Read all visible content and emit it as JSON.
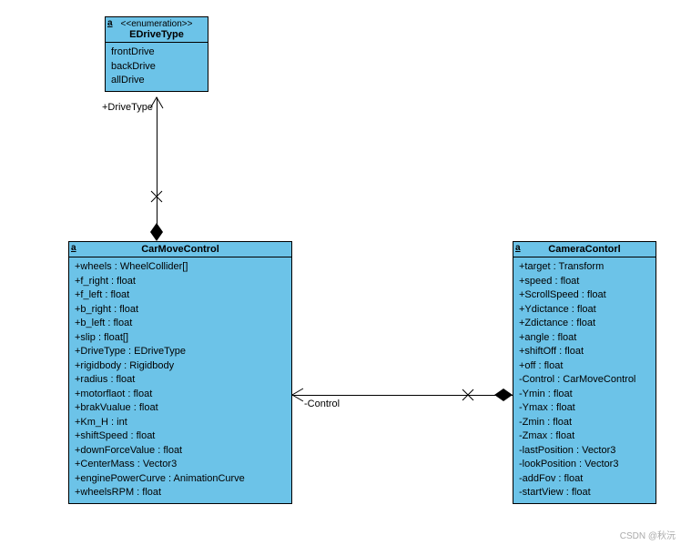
{
  "enum": {
    "stereotype": "<<enumeration>>",
    "name": "EDriveType",
    "values": [
      "frontDrive",
      "backDrive",
      "allDrive"
    ]
  },
  "carMove": {
    "name": "CarMoveControl",
    "attrs": [
      "+wheels : WheelCollider[]",
      "+f_right : float",
      "+f_left : float",
      "+b_right : float",
      "+b_left : float",
      "+slip : float[]",
      "+DriveType : EDriveType",
      "+rigidbody : Rigidbody",
      "+radius : float",
      "+motorflaot : float",
      "+brakVualue : float",
      "+Km_H : int",
      "+shiftSpeed : float",
      "+downForceValue : float",
      "+CenterMass : Vector3",
      "+enginePowerCurve : AnimationCurve",
      "+wheelsRPM : float"
    ]
  },
  "camera": {
    "name": "CameraContorl",
    "attrs": [
      "+target : Transform",
      "+speed : float",
      "+ScrollSpeed : float",
      "+Ydictance : float",
      "+Zdictance : float",
      "+angle : float",
      "+shiftOff : float",
      "+off : float",
      "-Control : CarMoveControl",
      "-Ymin : float",
      "-Ymax : float",
      "-Zmin : float",
      "-Zmax : float",
      "-lastPosition : Vector3",
      "-lookPosition : Vector3",
      "-addFov : float",
      "-startView : float"
    ]
  },
  "labels": {
    "driveType": "+DriveType",
    "control": "-Control"
  },
  "watermark": "CSDN @秋沅"
}
